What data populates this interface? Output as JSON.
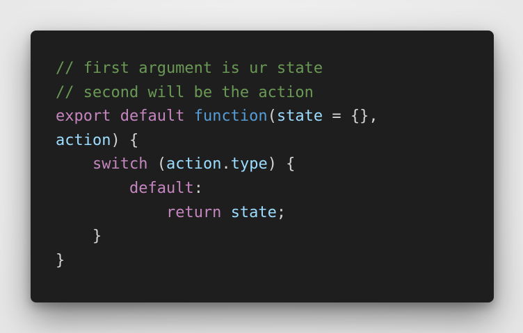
{
  "code": {
    "lines": [
      [
        {
          "t": "comment",
          "v": "// first argument is ur state"
        }
      ],
      [
        {
          "t": "comment",
          "v": "// second will be the action"
        }
      ],
      [
        {
          "t": "keyword",
          "v": "export"
        },
        {
          "t": "space",
          "v": " "
        },
        {
          "t": "keyword",
          "v": "default"
        },
        {
          "t": "space",
          "v": " "
        },
        {
          "t": "function",
          "v": "function"
        },
        {
          "t": "punct",
          "v": "("
        },
        {
          "t": "variable",
          "v": "state"
        },
        {
          "t": "punct",
          "v": " = {},"
        }
      ],
      [
        {
          "t": "variable",
          "v": "action"
        },
        {
          "t": "punct",
          "v": ") {"
        }
      ],
      [
        {
          "t": "space",
          "v": "    "
        },
        {
          "t": "keyword",
          "v": "switch"
        },
        {
          "t": "punct",
          "v": " ("
        },
        {
          "t": "variable",
          "v": "action"
        },
        {
          "t": "punct",
          "v": "."
        },
        {
          "t": "variable",
          "v": "type"
        },
        {
          "t": "punct",
          "v": ") {"
        }
      ],
      [
        {
          "t": "space",
          "v": "        "
        },
        {
          "t": "keyword",
          "v": "default"
        },
        {
          "t": "punct",
          "v": ":"
        }
      ],
      [
        {
          "t": "space",
          "v": "            "
        },
        {
          "t": "keyword",
          "v": "return"
        },
        {
          "t": "space",
          "v": " "
        },
        {
          "t": "variable",
          "v": "state"
        },
        {
          "t": "punct",
          "v": ";"
        }
      ],
      [
        {
          "t": "space",
          "v": "    "
        },
        {
          "t": "punct",
          "v": "}"
        }
      ],
      [
        {
          "t": "punct",
          "v": "}"
        }
      ]
    ]
  },
  "colors": {
    "background": "#ededed",
    "editor_background": "#1e1e1e",
    "comment": "#6a9955",
    "keyword": "#c586c0",
    "function": "#569cd6",
    "variable": "#9cdcfe",
    "punctuation": "#d4d4d4"
  }
}
